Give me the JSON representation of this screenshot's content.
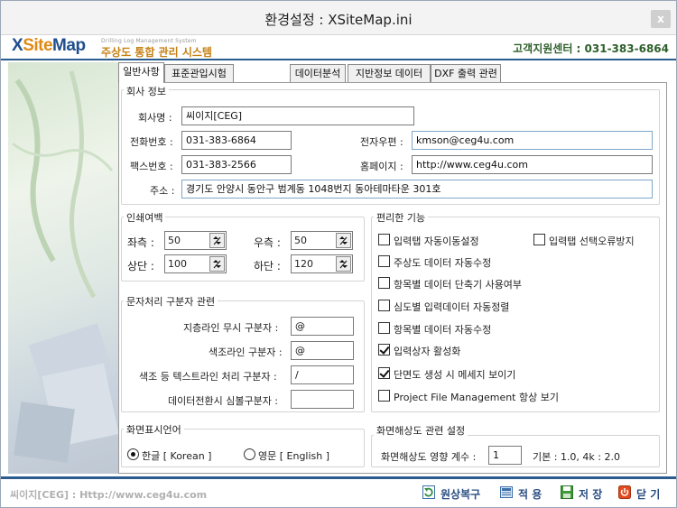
{
  "window": {
    "title": "환경설정 : XSiteMap.ini",
    "close_label": "x"
  },
  "header": {
    "logo_x": "X",
    "logo_site": "Site",
    "logo_map": "Map",
    "tagline": "Drilling Log Management System",
    "subtitle": "주상도 통합 관리 시스템",
    "support_label": "고객지원센터 : ",
    "support_phone": "031-383-6864"
  },
  "tabs": [
    {
      "label": "일반사항",
      "active": true
    },
    {
      "label": "표준관입시험"
    },
    {
      "label": "데이터분석"
    },
    {
      "label": "지반정보 데이터"
    },
    {
      "label": "DXF 출력 관련"
    }
  ],
  "company": {
    "group_title": "회사 정보",
    "name_label": "회사명 :",
    "name_value": "씨이지[CEG]",
    "phone_label": "전화번호 :",
    "phone_value": "031-383-6864",
    "email_label": "전자우편 :",
    "email_value": "kmson@ceg4u.com",
    "fax_label": "팩스번호 :",
    "fax_value": "031-383-2566",
    "homepage_label": "홈페이지 :",
    "homepage_value": "http://www.ceg4u.com",
    "address_label": "주소 :",
    "address_value": "경기도 안양시 동안구 범계동 1048번지 동아테마타운 301호"
  },
  "margins": {
    "group_title": "인쇄여백",
    "left_label": "좌측 :",
    "left_value": "50",
    "right_label": "우측 :",
    "right_value": "50",
    "top_label": "상단 :",
    "top_value": "100",
    "bottom_label": "하단 :",
    "bottom_value": "120"
  },
  "delimiters": {
    "group_title": "문자처리 구분자 관련",
    "strata_label": "지층라인 무시 구분자 :",
    "strata_value": "@",
    "color_label": "색조라인 구분자 :",
    "color_value": "@",
    "text_label": "색조 등 텍스트라인 처리 구분자 :",
    "text_value": "/",
    "symbol_label": "데이터전환시 심볼구분자 :",
    "symbol_value": ""
  },
  "features": {
    "group_title": "편리한 기능",
    "items": [
      {
        "label": "입력탭 자동이동설정",
        "checked": false
      },
      {
        "label": "입력탭 선택오류방지",
        "checked": false
      },
      {
        "label": "주상도 데이터 자동수정",
        "checked": false
      },
      {
        "label": "항목별 데이터 단축기 사용여부",
        "checked": false
      },
      {
        "label": "심도별 입력데이터 자동정렬",
        "checked": false
      },
      {
        "label": "항목별 데이터 자동수정",
        "checked": false
      },
      {
        "label": "입력상자 활성화",
        "checked": true
      },
      {
        "label": "단면도 생성 시 메세지 보이기",
        "checked": true
      },
      {
        "label": "Project File Management 항상 보기",
        "checked": false
      }
    ]
  },
  "language": {
    "group_title": "화면표시언어",
    "korean_label": "한글 [ Korean ]",
    "english_label": "영문 [ English ]",
    "selected": "korean"
  },
  "resolution": {
    "group_title": "화면해상도 관련 설정",
    "factor_label": "화면해상도 영향 계수 :",
    "factor_value": "1",
    "default_note": "기본 : 1.0, 4k : 2.0"
  },
  "footer": {
    "left_text": "씨이지[CEG] : Http://www.ceg4u.com",
    "restore_label": "원상복구",
    "apply_label": "적 용",
    "save_label": "저 장",
    "close_label": "닫 기"
  },
  "colors": {
    "accent": "#2b5c8f",
    "logo_blue": "#1f4f8d",
    "logo_orange": "#e08a16",
    "support_green": "#2d5f2a"
  }
}
